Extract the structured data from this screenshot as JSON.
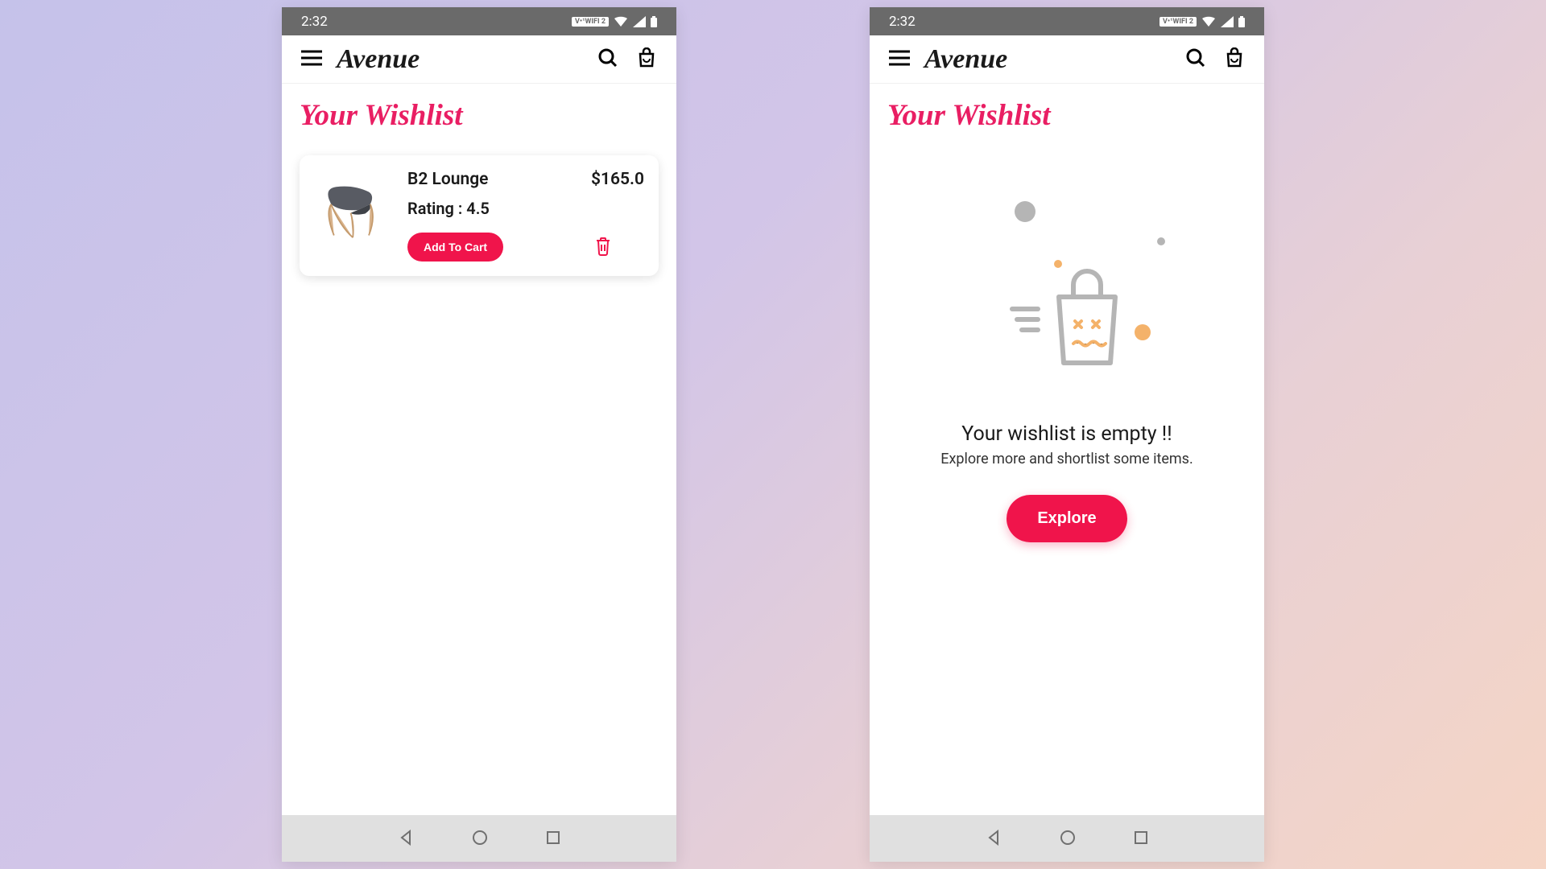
{
  "status": {
    "time": "2:32",
    "wifi_label": "V•¹WIFI 2"
  },
  "brand": "Avenue",
  "page_title": "Your Wishlist",
  "wishlist": {
    "items": [
      {
        "name": "B2 Lounge",
        "price": "$165.0",
        "rating": "Rating : 4.5",
        "cta": "Add To Cart"
      }
    ]
  },
  "empty": {
    "title": "Your wishlist is empty !!",
    "subtitle": "Explore more and shortlist some items.",
    "cta": "Explore"
  },
  "colors": {
    "accent": "#f0144b",
    "title": "#e91e63"
  }
}
